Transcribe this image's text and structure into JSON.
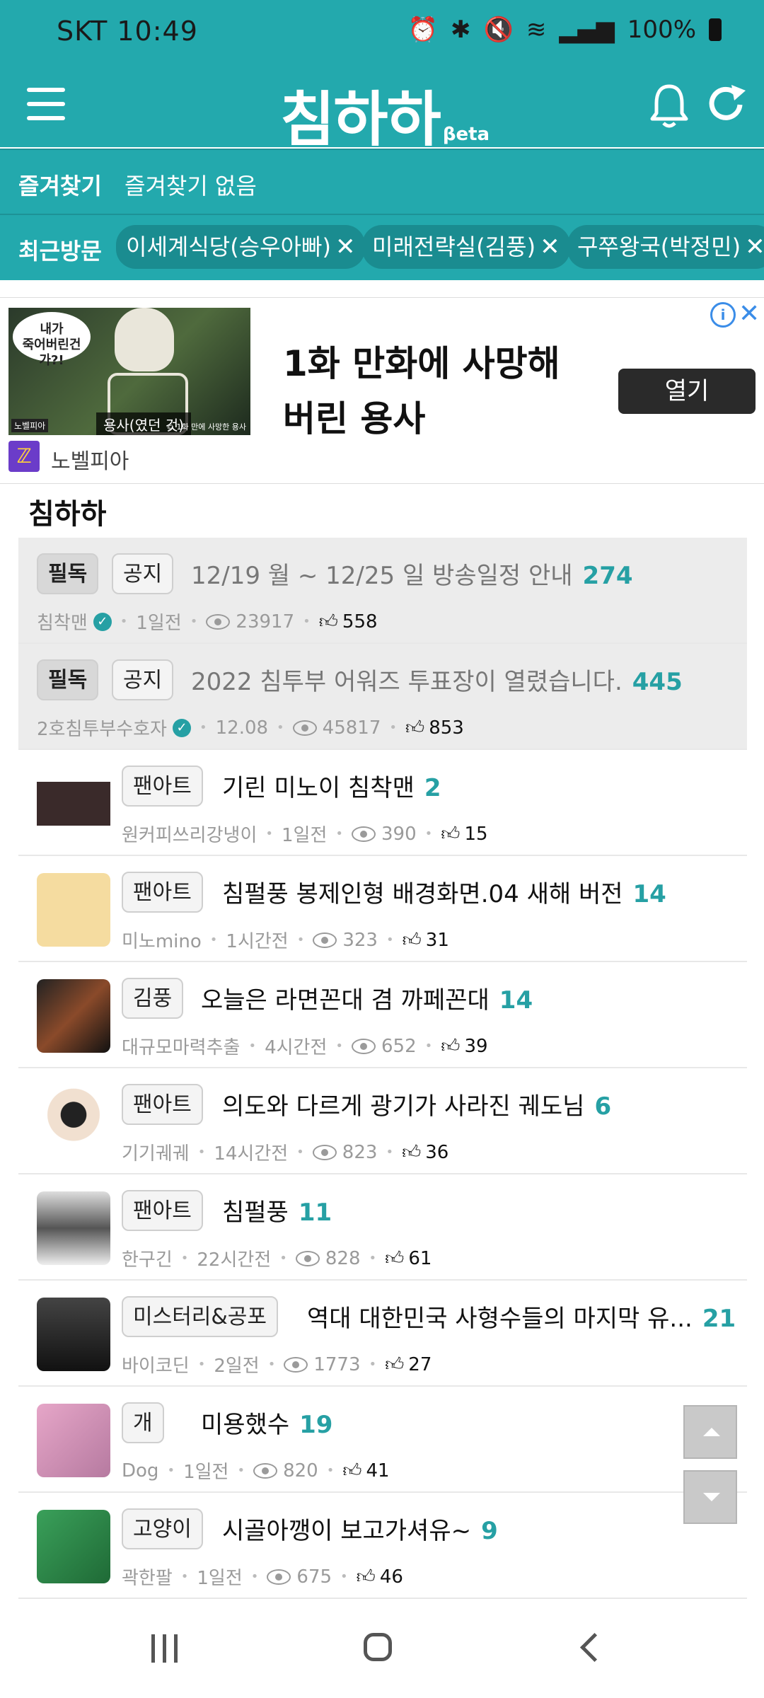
{
  "status_bar": {
    "time": "SKT 10:49",
    "battery": "100%"
  },
  "header": {
    "logo": "침하하",
    "logo_suffix": "βeta",
    "icons": [
      "menu-icon",
      "bell-icon",
      "refresh-icon"
    ]
  },
  "favorites": {
    "label": "즐겨찾기",
    "value": "즐겨찾기 없음"
  },
  "recent": {
    "label": "최근방문",
    "chips": [
      "이세계식당(승우아빠)",
      "미래전략실(김풍)",
      "구쭈왕국(박정민)"
    ]
  },
  "ad": {
    "headline_line1": "1화 만화에 사망해",
    "headline_line2": "버린 용사",
    "open_button": "열기",
    "source": "노벨피아",
    "thumb_bubble": "내가\n죽어버린건가?!",
    "thumb_caption": "용사(였던 것)",
    "thumb_small": "© 1화 만에 사망한 용사",
    "thumb_brand": "노벨피아"
  },
  "section": {
    "title": "침하하"
  },
  "posts": [
    {
      "badges": [
        "필독",
        "공지"
      ],
      "title": "12/19 월 ~ 12/25 일 방송일정 안내",
      "comments": "274",
      "author": "침착맨",
      "verified": true,
      "time": "1일전",
      "views": "23917",
      "likes": "558",
      "notice": true
    },
    {
      "badges": [
        "필독",
        "공지"
      ],
      "title": "2022 침투부 어워즈 투표장이 열렸습니다.",
      "comments": "445",
      "author": "2호침투부수호자",
      "verified": true,
      "time": "12.08",
      "views": "45817",
      "likes": "853",
      "notice": true
    },
    {
      "badges": [
        "팬아트"
      ],
      "title": "기린 미노이 침착맨",
      "comments": "2",
      "author": "원커피쓰리강냉이",
      "time": "1일전",
      "views": "390",
      "likes": "15"
    },
    {
      "badges": [
        "팬아트"
      ],
      "title": "침펄풍 봉제인형 배경화면.04 새해 버전",
      "comments": "14",
      "author": "미노mino",
      "time": "1시간전",
      "views": "323",
      "likes": "31"
    },
    {
      "badges": [
        "김풍"
      ],
      "title": "오늘은 라면꼰대 겸 까페꼰대",
      "comments": "14",
      "author": "대규모마력추출",
      "time": "4시간전",
      "views": "652",
      "likes": "39"
    },
    {
      "badges": [
        "팬아트"
      ],
      "title": "의도와 다르게 광기가 사라진 궤도님",
      "comments": "6",
      "author": "기기궤궤",
      "time": "14시간전",
      "views": "823",
      "likes": "36"
    },
    {
      "badges": [
        "팬아트"
      ],
      "title": "침펄풍",
      "comments": "11",
      "author": "한구긴",
      "time": "22시간전",
      "views": "828",
      "likes": "61"
    },
    {
      "badges": [
        "미스터리&공포"
      ],
      "title": "역대 대한민국 사형수들의 마지막 유...",
      "comments": "21",
      "author": "바이코딘",
      "time": "2일전",
      "views": "1773",
      "likes": "27"
    },
    {
      "badges": [
        "개"
      ],
      "title": "미용했수",
      "comments": "19",
      "author": "Dog",
      "time": "1일전",
      "views": "820",
      "likes": "41"
    },
    {
      "badges": [
        "고양이"
      ],
      "title": "시골아깽이 보고가셔유~",
      "comments": "9",
      "author": "곽한팔",
      "time": "1일전",
      "views": "675",
      "likes": "46"
    }
  ],
  "colors": {
    "accent": "#23a9ad",
    "comment": "#26a0a4"
  }
}
